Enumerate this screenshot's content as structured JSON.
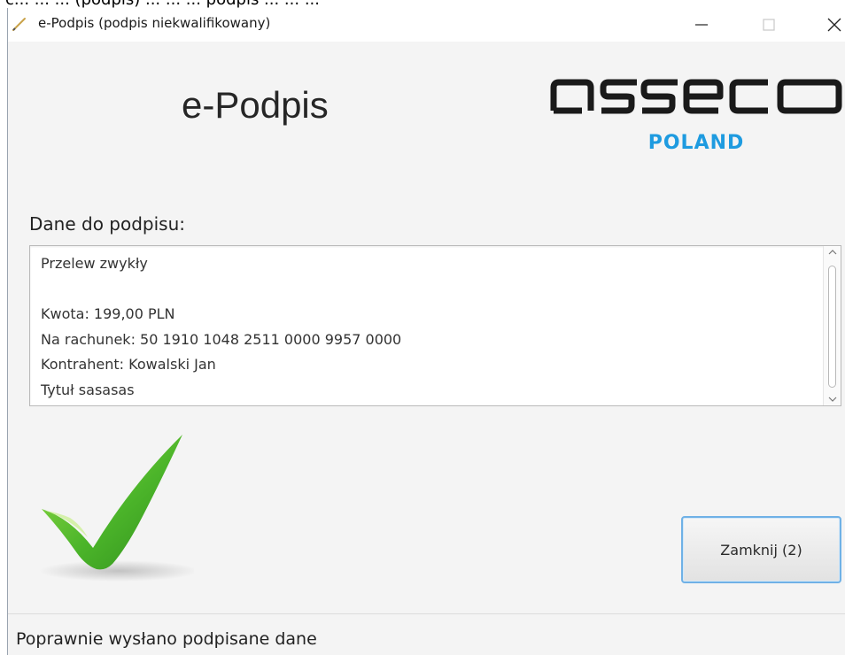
{
  "window": {
    "title": "e-Podpis (podpis niekwalifikowany)",
    "behind_text": "c... ... ... (podpis) ... ... ... podpis ... ... ..."
  },
  "header": {
    "app_title": "e-Podpis",
    "logo_text": "asseco",
    "logo_subtitle": "POLAND",
    "logo_color": "#1e9be0"
  },
  "signing_data": {
    "label": "Dane do podpisu:",
    "lines": [
      "Przelew zwykły",
      "",
      "Kwota: 199,00 PLN",
      "Na rachunek: 50 1910 1048 2511 0000 9957 0000",
      "Kontrahent: Kowalski Jan",
      "Tytuł sasasas"
    ]
  },
  "status_icon": "checkmark-icon",
  "actions": {
    "close_label": "Zamknij (2)",
    "accent_color": "#6fb1e6"
  },
  "statusbar": {
    "message": "Poprawnie wysłano podpisane dane"
  },
  "icons": {
    "app": "pen-icon",
    "minimize": "minimize-icon",
    "maximize": "maximize-icon",
    "close": "close-icon"
  }
}
